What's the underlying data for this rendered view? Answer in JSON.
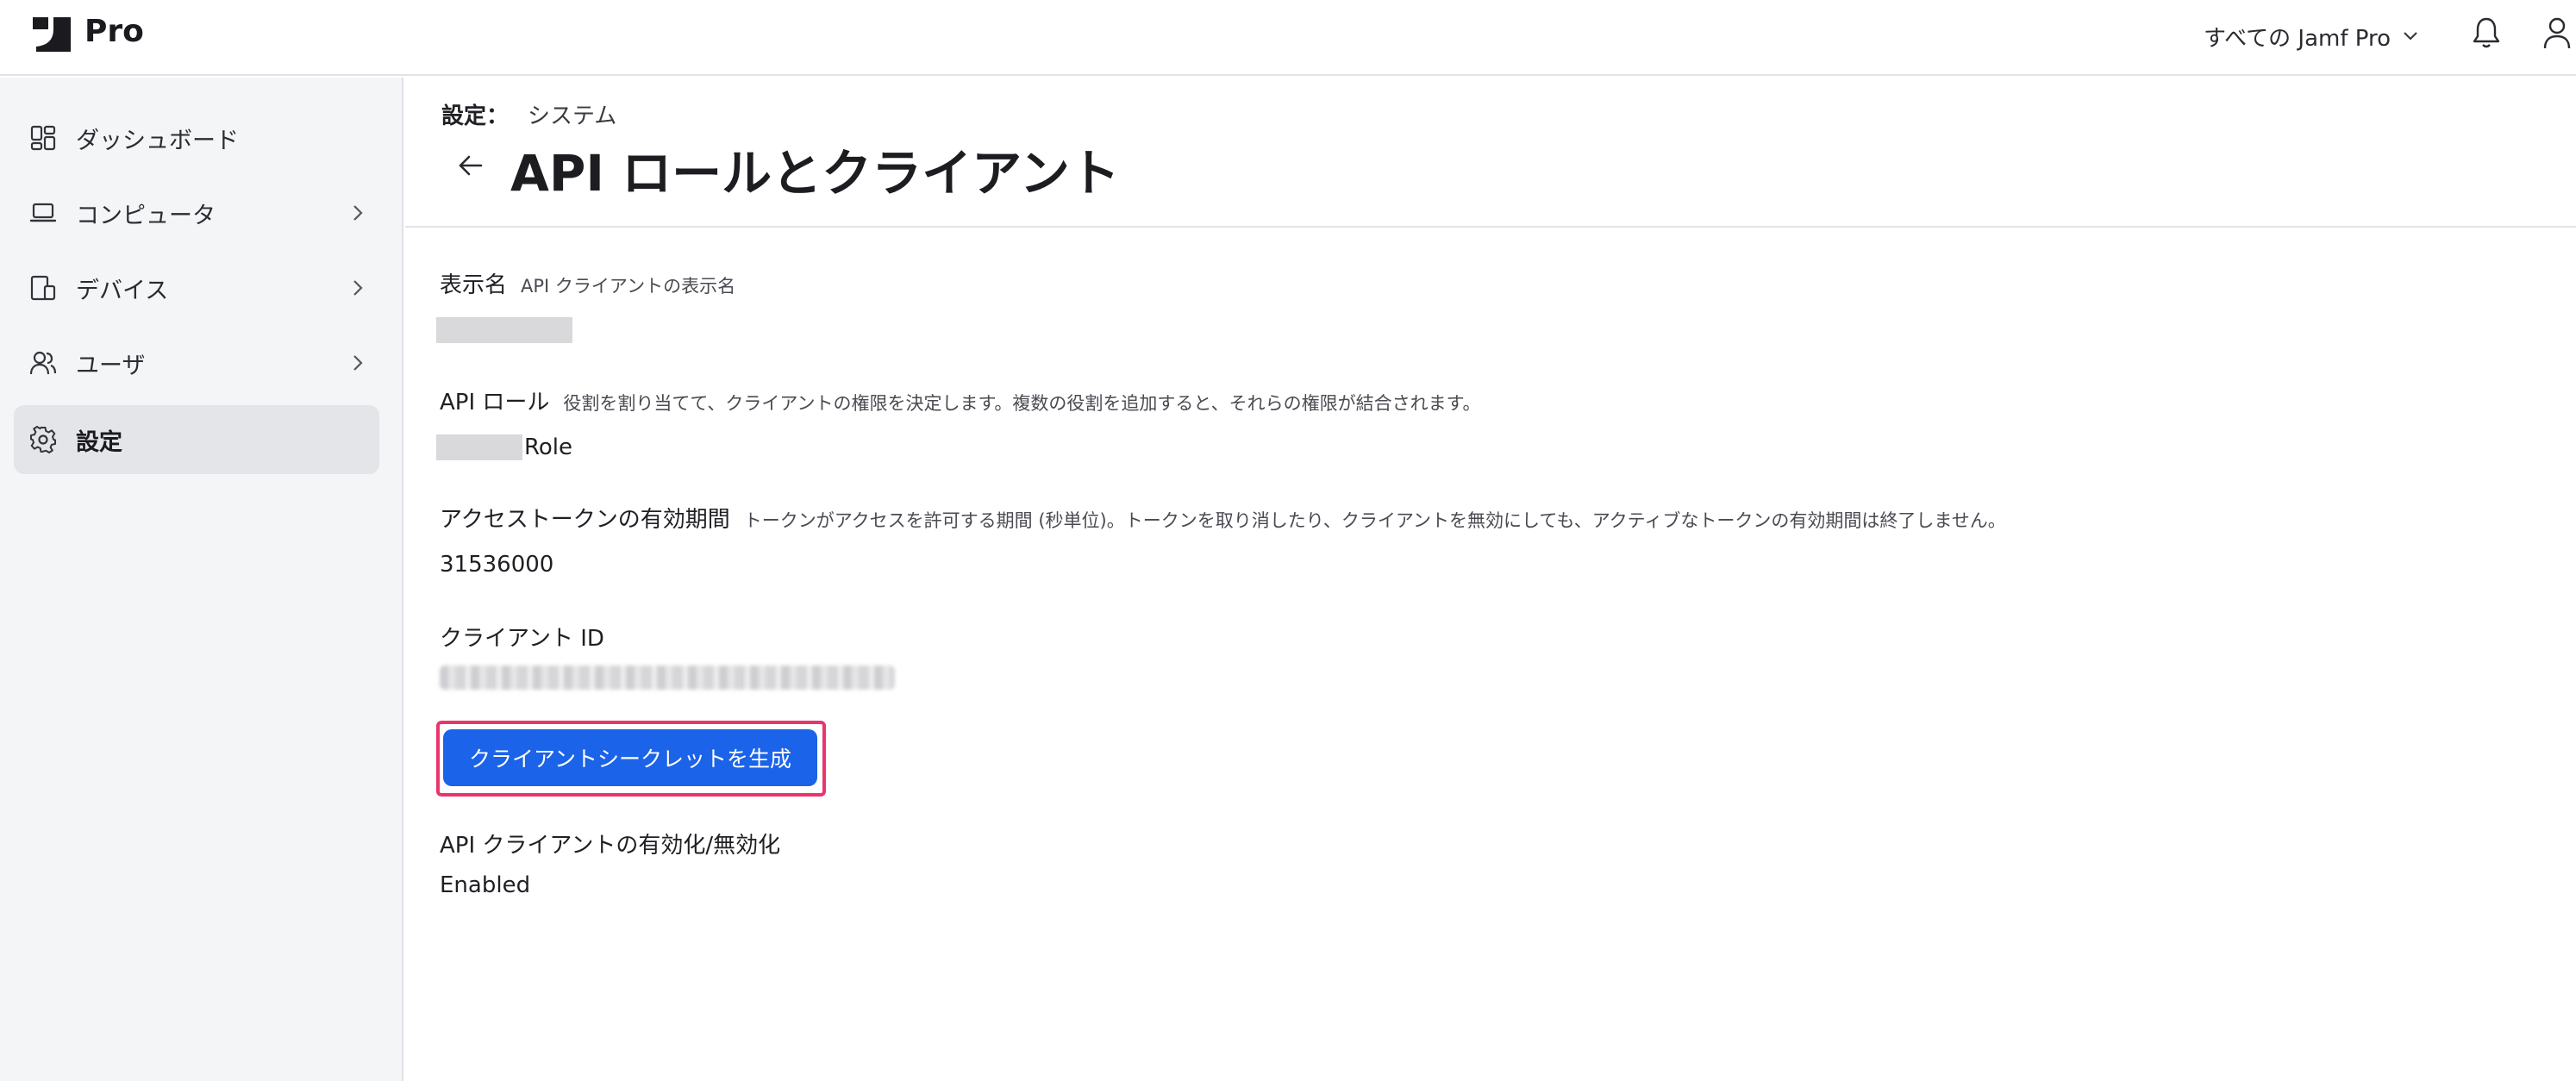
{
  "app": {
    "brand": "Pro"
  },
  "topbar": {
    "environment": "すべての Jamf Pro"
  },
  "sidebar": {
    "items": [
      {
        "label": "ダッシュボード",
        "icon": "dashboard-icon"
      },
      {
        "label": "コンピュータ",
        "icon": "laptop-icon"
      },
      {
        "label": "デバイス",
        "icon": "devices-icon"
      },
      {
        "label": "ユーザ",
        "icon": "users-icon"
      },
      {
        "label": "設定",
        "icon": "gear-icon",
        "active": true
      }
    ]
  },
  "header": {
    "breadcrumb_prefix": "設定：",
    "breadcrumb_current": "システム",
    "title": "API ロールとクライアント"
  },
  "form": {
    "display_name": {
      "label": "表示名",
      "help": "API クライアントの表示名"
    },
    "api_role": {
      "label": "API ロール",
      "help": "役割を割り当てて、クライアントの権限を決定します。複数の役割を追加すると、それらの権限が結合されます。",
      "value_suffix": "Role"
    },
    "token_lifetime": {
      "label": "アクセストークンの有効期間",
      "help": "トークンがアクセスを許可する期間 (秒単位)。トークンを取り消したり、クライアントを無効にしても、アクティブなトークンの有効期間は終了しません。",
      "value": "31536000"
    },
    "client_id": {
      "label": "クライアント ID"
    },
    "generate_button": "クライアントシークレットを生成",
    "enable_toggle": {
      "label": "API クライアントの有効化/無効化",
      "value": "Enabled"
    }
  },
  "colors": {
    "primary": "#1b63e8",
    "highlight": "#e8356d",
    "sidebar_bg": "#f4f5f7"
  }
}
